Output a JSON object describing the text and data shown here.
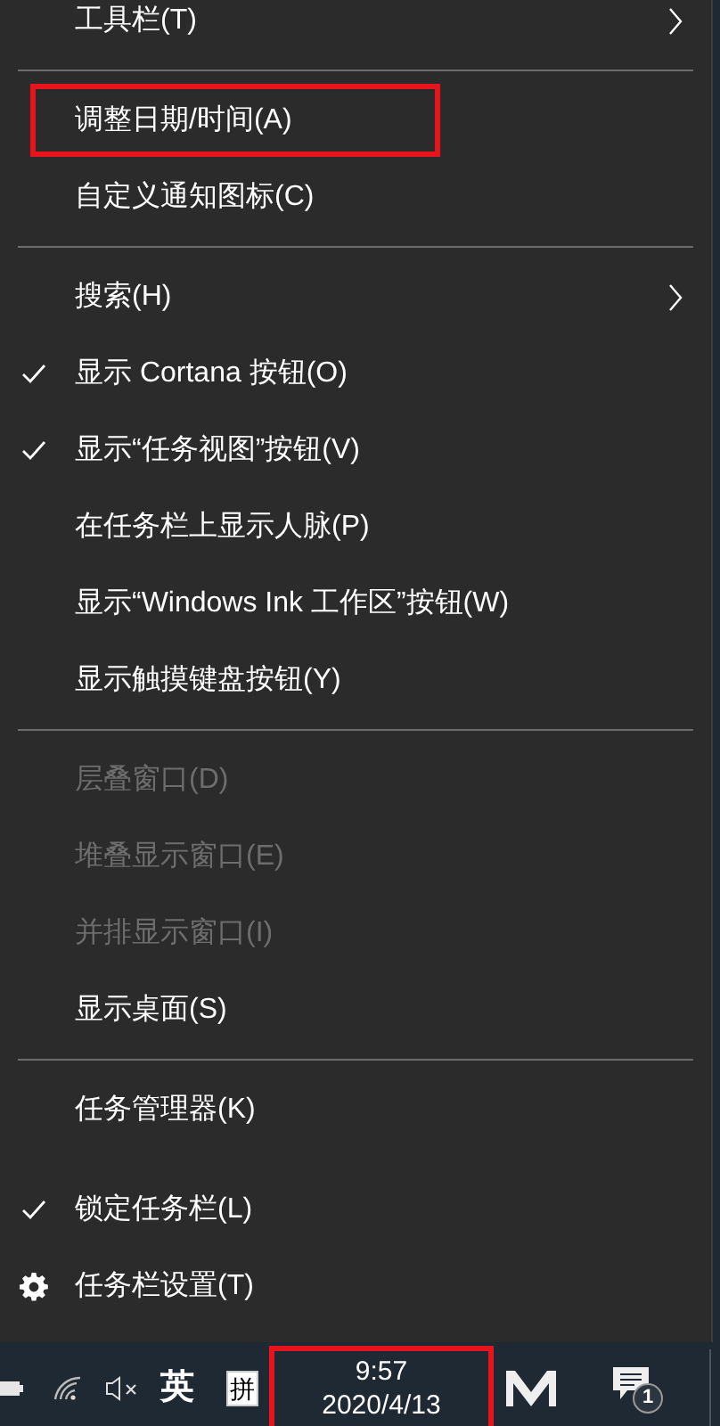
{
  "menu": {
    "items": [
      {
        "kind": "item",
        "label": "工具栏(T)",
        "submenu": true,
        "checked": false,
        "disabled": false,
        "highlighted": false
      },
      {
        "kind": "separator"
      },
      {
        "kind": "item",
        "label": "调整日期/时间(A)",
        "submenu": false,
        "checked": false,
        "disabled": false,
        "highlighted": true
      },
      {
        "kind": "item",
        "label": "自定义通知图标(C)",
        "submenu": false,
        "checked": false,
        "disabled": false,
        "highlighted": false
      },
      {
        "kind": "separator"
      },
      {
        "kind": "item",
        "label": "搜索(H)",
        "submenu": true,
        "checked": false,
        "disabled": false,
        "highlighted": false
      },
      {
        "kind": "item",
        "label": "显示 Cortana 按钮(O)",
        "submenu": false,
        "checked": true,
        "disabled": false,
        "highlighted": false
      },
      {
        "kind": "item",
        "label": "显示“任务视图”按钮(V)",
        "submenu": false,
        "checked": true,
        "disabled": false,
        "highlighted": false
      },
      {
        "kind": "item",
        "label": "在任务栏上显示人脉(P)",
        "submenu": false,
        "checked": false,
        "disabled": false,
        "highlighted": false
      },
      {
        "kind": "item",
        "label": "显示“Windows Ink 工作区”按钮(W)",
        "submenu": false,
        "checked": false,
        "disabled": false,
        "highlighted": false
      },
      {
        "kind": "item",
        "label": "显示触摸键盘按钮(Y)",
        "submenu": false,
        "checked": false,
        "disabled": false,
        "highlighted": false
      },
      {
        "kind": "separator"
      },
      {
        "kind": "item",
        "label": "层叠窗口(D)",
        "submenu": false,
        "checked": false,
        "disabled": true,
        "highlighted": false
      },
      {
        "kind": "item",
        "label": "堆叠显示窗口(E)",
        "submenu": false,
        "checked": false,
        "disabled": true,
        "highlighted": false
      },
      {
        "kind": "item",
        "label": "并排显示窗口(I)",
        "submenu": false,
        "checked": false,
        "disabled": true,
        "highlighted": false
      },
      {
        "kind": "item",
        "label": "显示桌面(S)",
        "submenu": false,
        "checked": false,
        "disabled": false,
        "highlighted": false
      },
      {
        "kind": "separator"
      },
      {
        "kind": "item",
        "label": "任务管理器(K)",
        "submenu": false,
        "checked": false,
        "disabled": false,
        "highlighted": false
      },
      {
        "kind": "spacer"
      },
      {
        "kind": "item",
        "label": "锁定任务栏(L)",
        "submenu": false,
        "checked": true,
        "disabled": false,
        "highlighted": false
      },
      {
        "kind": "settings",
        "label": "任务栏设置(T)",
        "submenu": false,
        "checked": false,
        "disabled": false,
        "highlighted": false
      }
    ]
  },
  "taskbar": {
    "input_language": "英",
    "ime_mode": "拼",
    "clock": {
      "time": "9:57",
      "date": "2020/4/13",
      "highlighted": true
    },
    "notification_count": "1"
  }
}
